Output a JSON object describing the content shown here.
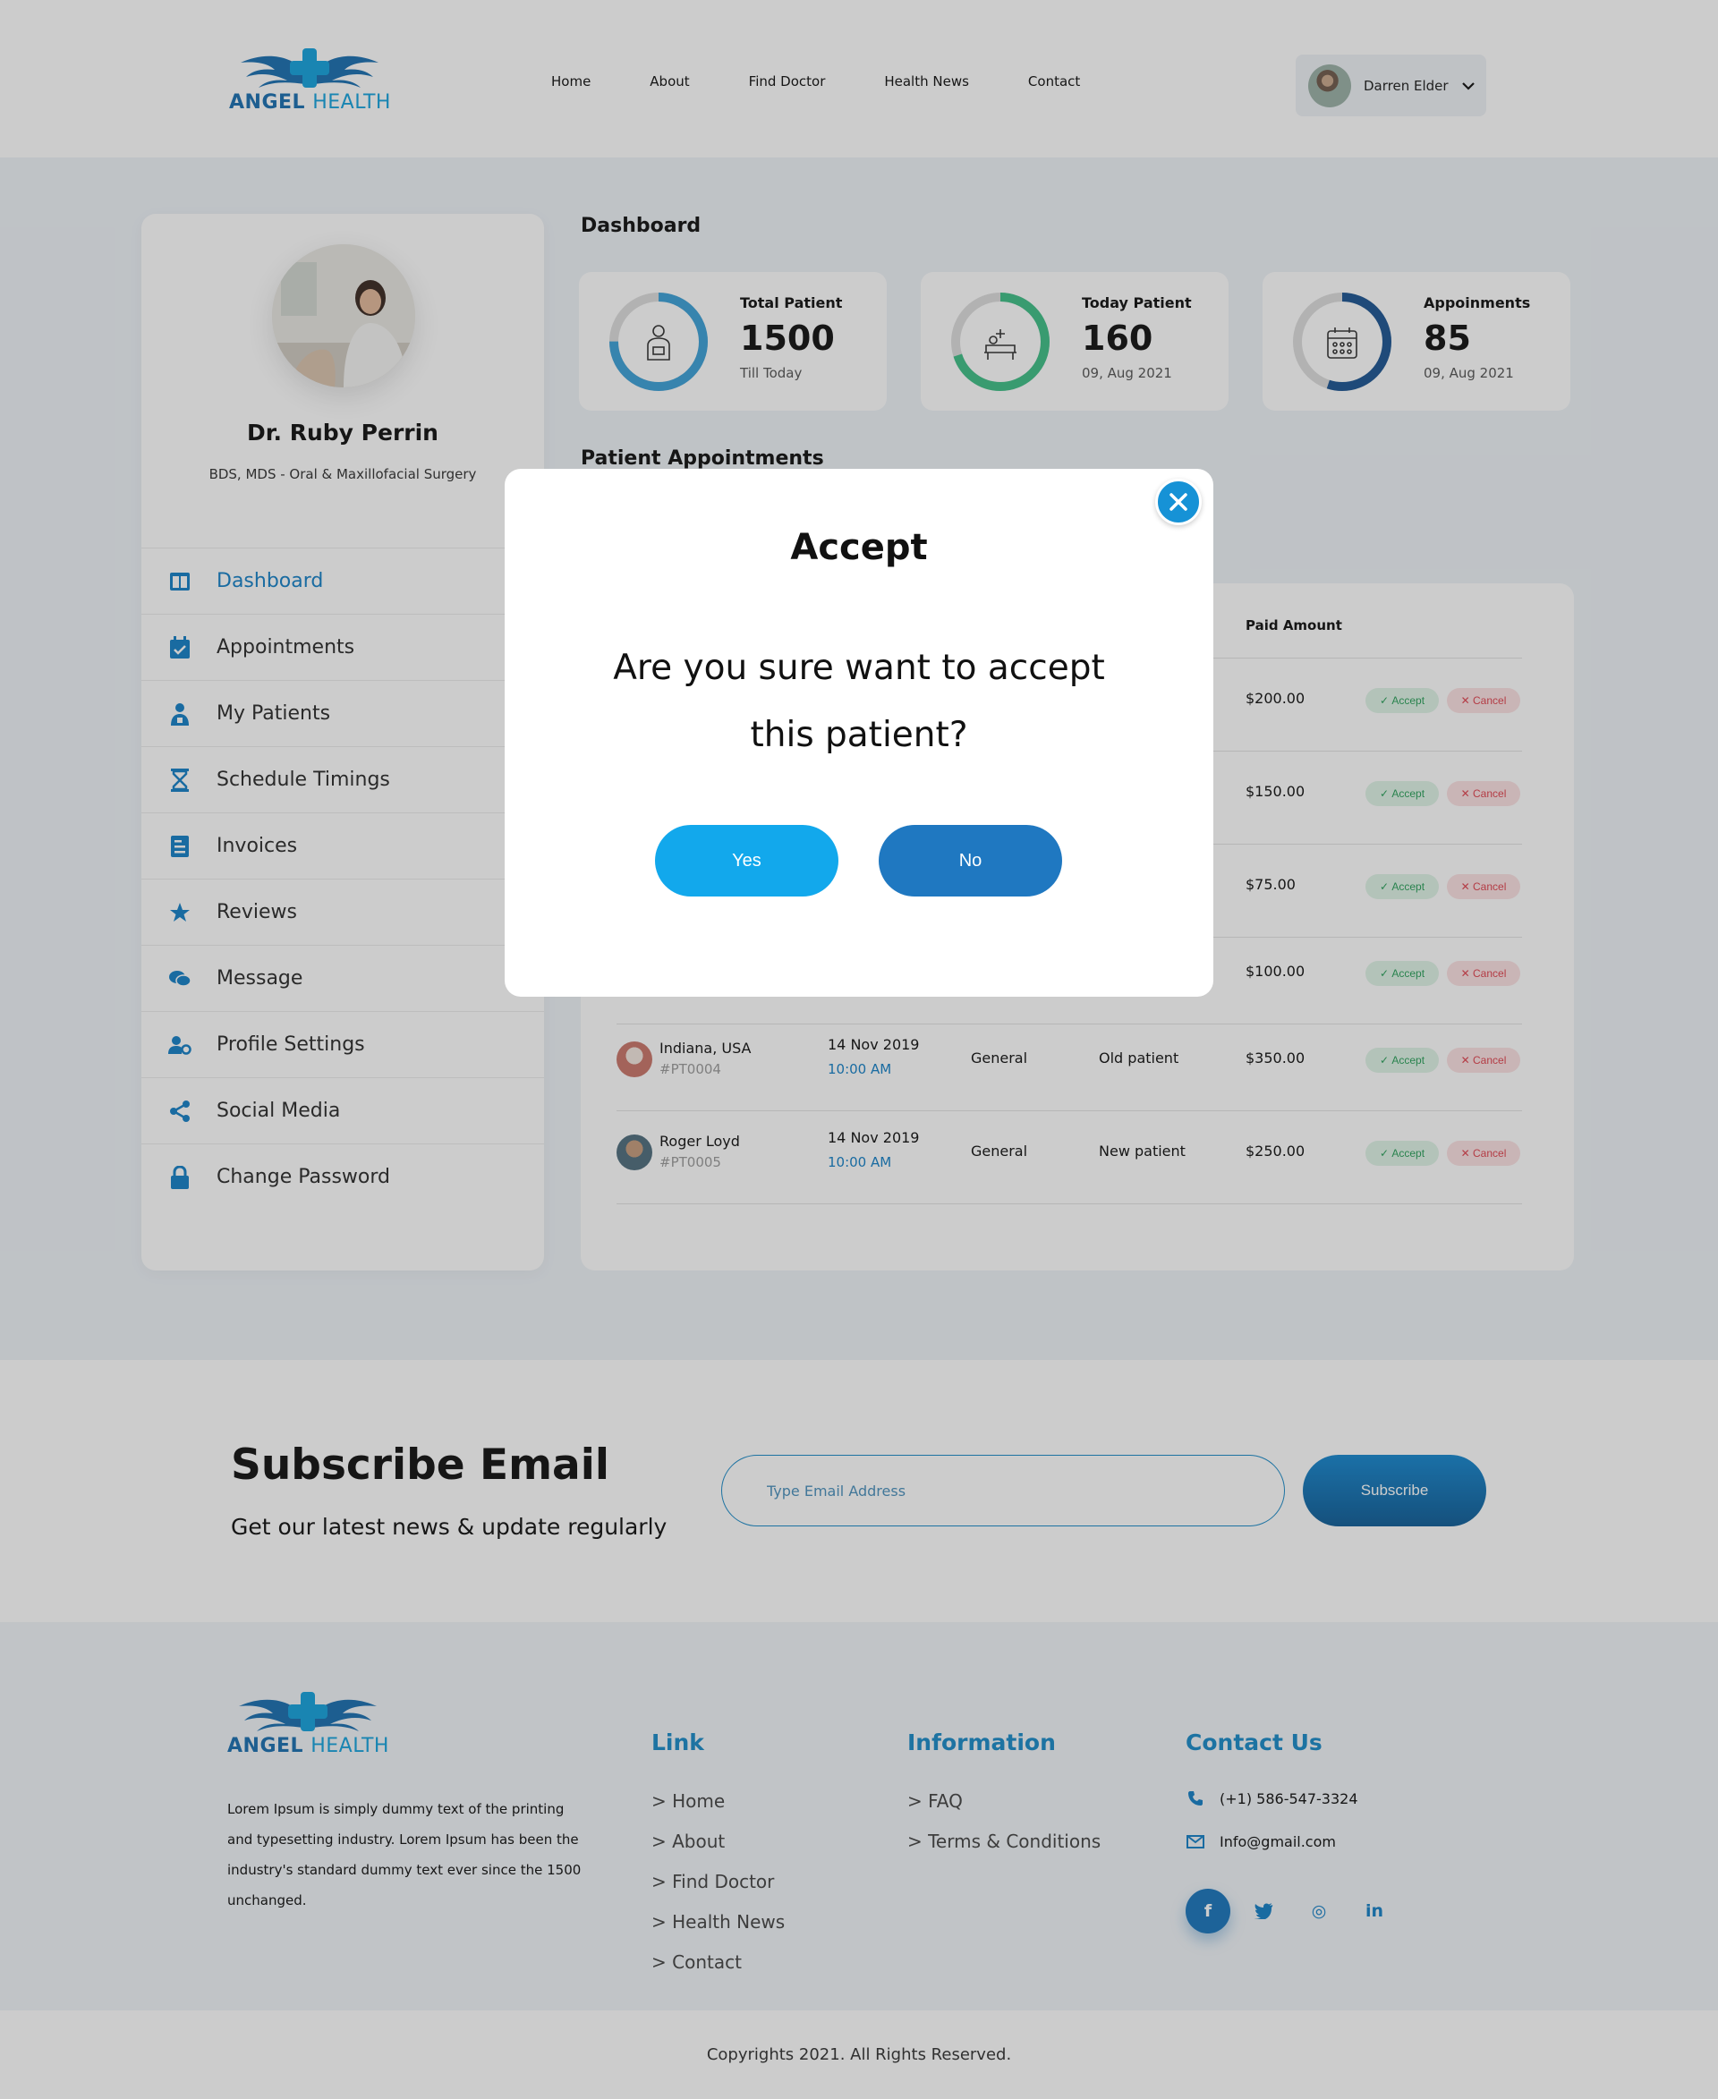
{
  "header": {
    "logo": {
      "word1": "ANGEL",
      "word2": "HEALTH"
    },
    "nav": [
      "Home",
      "About",
      "Find Doctor",
      "Health News",
      "Contact"
    ],
    "user": {
      "name": "Darren Elder"
    }
  },
  "sidebar": {
    "doctor_name": "Dr. Ruby Perrin",
    "specialty": "BDS, MDS - Oral & Maxillofacial Surgery",
    "items": [
      {
        "label": "Dashboard",
        "icon": "dashboard-icon",
        "active": true
      },
      {
        "label": "Appointments",
        "icon": "calendar-check-icon"
      },
      {
        "label": "My Patients",
        "icon": "patient-icon"
      },
      {
        "label": "Schedule Timings",
        "icon": "hourglass-icon"
      },
      {
        "label": "Invoices",
        "icon": "invoice-icon"
      },
      {
        "label": "Reviews",
        "icon": "star-icon"
      },
      {
        "label": "Message",
        "icon": "chat-icon"
      },
      {
        "label": "Profile Settings",
        "icon": "user-cog-icon"
      },
      {
        "label": "Social Media",
        "icon": "share-icon"
      },
      {
        "label": "Change Password",
        "icon": "lock-icon"
      }
    ]
  },
  "dashboard": {
    "title": "Dashboard",
    "stats": [
      {
        "label": "Total Patient",
        "value": "1500",
        "sub": "Till Today",
        "color": "#3ca1d8",
        "progress": 0.75
      },
      {
        "label": "Today Patient",
        "value": "160",
        "sub": "09, Aug 2021",
        "color": "#3fbf87",
        "progress": 0.7
      },
      {
        "label": "Appoinments",
        "value": "85",
        "sub": "09, Aug 2021",
        "color": "#1c5592",
        "progress": 0.55
      }
    ]
  },
  "appointments": {
    "title": "Patient Appointments",
    "paid_header": "Paid Amount",
    "accept_label": "Accept",
    "cancel_label": "Cancel",
    "rows": [
      {
        "amount": "$200.00"
      },
      {
        "amount": "$150.00"
      },
      {
        "amount": "$75.00"
      },
      {
        "amount": "$100.00"
      },
      {
        "name": "Indiana, USA",
        "id": "#PT0004",
        "date": "14 Nov 2019",
        "time": "10:00 AM",
        "purpose": "General",
        "type": "Old patient",
        "amount": "$350.00"
      },
      {
        "name": "Roger Loyd",
        "id": "#PT0005",
        "date": "14 Nov 2019",
        "time": "10:00 AM",
        "purpose": "General",
        "type": "New patient",
        "amount": "$250.00"
      }
    ]
  },
  "modal": {
    "title": "Accept",
    "message": "Are you sure want to accept this patient?",
    "yes_label": "Yes",
    "no_label": "No"
  },
  "subscribe": {
    "title": "Subscribe Email",
    "text": "Get our latest news & update regularly",
    "placeholder": "Type Email Address",
    "button": "Subscribe"
  },
  "footer": {
    "description": "Lorem Ipsum is simply dummy text of the printing and typesetting industry. Lorem Ipsum has been the industry's standard dummy text ever since the 1500 unchanged.",
    "link_heading": "Link",
    "links": [
      "> Home",
      "> About",
      "> Find Doctor",
      "> Health News",
      "> Contact"
    ],
    "info_heading": "Information",
    "info_links": [
      "> FAQ",
      "> Terms & Conditions"
    ],
    "contact_heading": "Contact Us",
    "phone": "(+1) 586-547-3324",
    "email": "Info@gmail.com",
    "social": {
      "facebook": "f",
      "instagram": "◎",
      "linkedin": "in"
    }
  },
  "copyright": "Copyrights 2021. All Rights Reserved.",
  "colors": {
    "brand": "#1a8ac8",
    "accent": "#12a8ec",
    "dark_blue": "#1f78c1",
    "accept": "#2aa05a",
    "cancel": "#e0424e"
  }
}
